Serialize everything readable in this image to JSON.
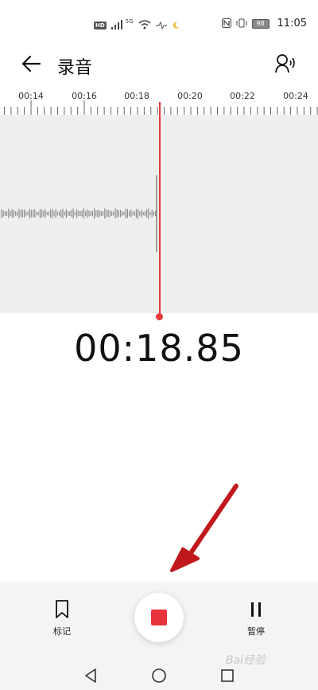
{
  "status_bar": {
    "network_badge": "HD",
    "signal_label": "5G",
    "battery_level": "98",
    "time": "11:05"
  },
  "header": {
    "title": "录音",
    "back_icon": "arrow-left-icon",
    "voice_icon": "voice-person-icon"
  },
  "timeline": {
    "labels": [
      "00:14",
      "00:16",
      "00:18",
      "00:20",
      "00:22",
      "00:24"
    ]
  },
  "recording": {
    "elapsed": "00:18.85"
  },
  "controls": {
    "mark_label": "标记",
    "pause_label": "暂停",
    "mark_icon": "bookmark-icon",
    "stop_icon": "stop-icon",
    "pause_icon": "pause-icon"
  },
  "nav": {
    "back_icon": "triangle-back-icon",
    "home_icon": "circle-home-icon",
    "recents_icon": "square-recents-icon"
  },
  "watermark": "Bai经验",
  "colors": {
    "accent": "#e8333a",
    "playhead": "#e33a3a",
    "wave_bg": "#efefef",
    "annotation_arrow": "#c0181c"
  }
}
